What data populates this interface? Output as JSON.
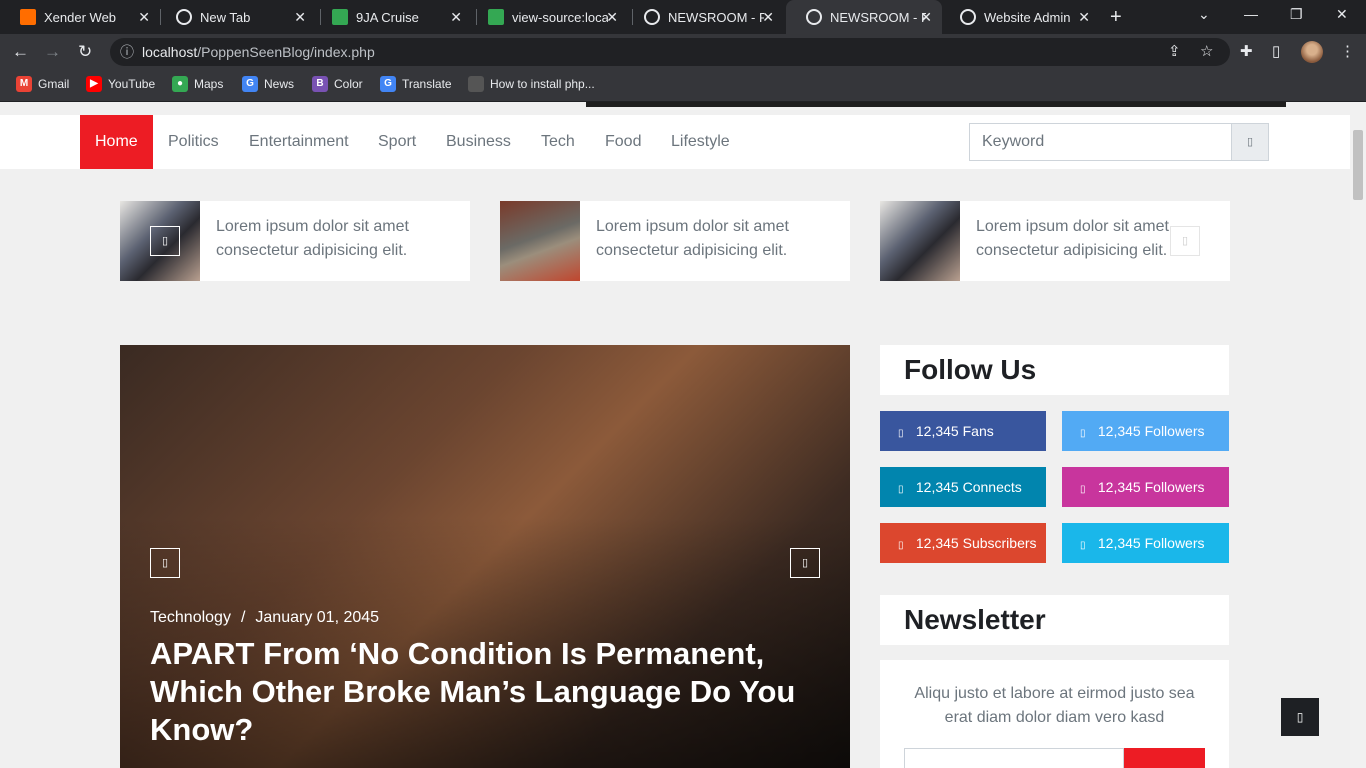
{
  "browser": {
    "tabs": [
      {
        "title": "Xender Web",
        "icon": "xender-icon",
        "color": "#ff6d00"
      },
      {
        "title": "New Tab",
        "icon": "chrome-icon",
        "color": "#e8eaed"
      },
      {
        "title": "9JA Cruise",
        "icon": "site-icon",
        "color": "#34a853"
      },
      {
        "title": "view-source:localh",
        "icon": "site-icon",
        "color": "#34a853"
      },
      {
        "title": "NEWSROOM - Fr",
        "icon": "globe-icon",
        "color": "#e8eaed"
      },
      {
        "title": "NEWSROOM - Fr",
        "icon": "globe-icon",
        "color": "#e8eaed"
      },
      {
        "title": "Website Admin",
        "icon": "globe-icon",
        "color": "#e8eaed"
      }
    ],
    "address": {
      "host": "localhost",
      "path": "/PoppenSeenBlog/index.php"
    },
    "bookmarks": [
      {
        "label": "Gmail",
        "color": "#ea4335",
        "glyph": "M"
      },
      {
        "label": "YouTube",
        "color": "#ff0000",
        "glyph": "▶"
      },
      {
        "label": "Maps",
        "color": "#34a853",
        "glyph": "●"
      },
      {
        "label": "News",
        "color": "#4285f4",
        "glyph": "G"
      },
      {
        "label": "Color",
        "color": "#7952b3",
        "glyph": "B"
      },
      {
        "label": "Translate",
        "color": "#4285f4",
        "glyph": "G"
      },
      {
        "label": "How to install php...",
        "color": "#555555",
        "glyph": ""
      }
    ]
  },
  "nav": {
    "items": [
      "Home",
      "Politics",
      "Entertainment",
      "Sport",
      "Business",
      "Tech",
      "Food",
      "Lifestyle"
    ],
    "search_placeholder": "Keyword",
    "accent": "#ed1c24"
  },
  "teasers": [
    {
      "text": "Lorem ipsum dolor sit amet consectetur adipisicing elit."
    },
    {
      "text": "Lorem ipsum dolor sit amet consectetur adipisicing elit."
    },
    {
      "text": "Lorem ipsum dolor sit amet consectetur adipisicing elit."
    }
  ],
  "hero": {
    "category": "Technology",
    "separator": "/",
    "date": "January 01, 2045",
    "headline": "APART From ‘No Condition Is Permanent, Which Other Broke Man’s Language Do You Know?"
  },
  "follow": {
    "title": "Follow Us",
    "items": [
      {
        "label": "12,345 Fans",
        "color": "#39569e"
      },
      {
        "label": "12,345 Followers",
        "color": "#52aaf4"
      },
      {
        "label": "12,345 Connects",
        "color": "#0185ae"
      },
      {
        "label": "12,345 Followers",
        "color": "#c8359d"
      },
      {
        "label": "12,345 Subscribers",
        "color": "#dc472e"
      },
      {
        "label": "12,345 Followers",
        "color": "#1ab7ea"
      }
    ]
  },
  "newsletter": {
    "title": "Newsletter",
    "text": "Aliqu justo et labore at eirmod justo sea erat diam dolor diam vero kasd"
  }
}
